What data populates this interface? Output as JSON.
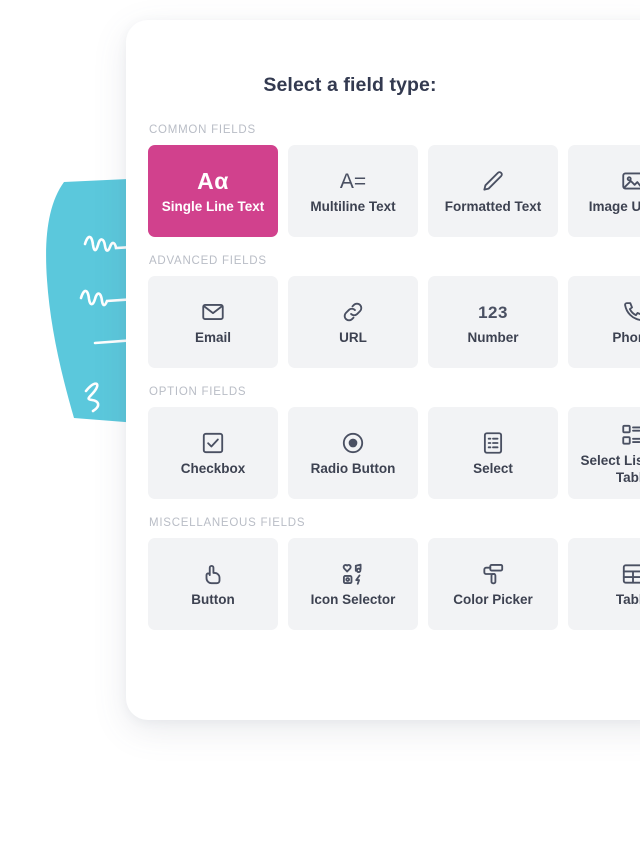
{
  "panel": {
    "title": "Select a field type:"
  },
  "colors": {
    "accent_pink": "#d1418d",
    "cyan_shape": "#5bc8dc",
    "card_background": "#f2f3f5",
    "card_text": "#3d4251",
    "section_label": "#b9bdc6",
    "panel_background": "#ffffff",
    "page_background": "#ffffff"
  },
  "sections": [
    {
      "label": "COMMON FIELDS",
      "cards": [
        {
          "label": "Single Line Text",
          "icon": "aa-text-icon",
          "selected": true
        },
        {
          "label": "Multiline Text",
          "icon": "multiline-text-icon",
          "selected": false
        },
        {
          "label": "Formatted Text",
          "icon": "pencil-icon",
          "selected": false
        },
        {
          "label": "Image Upload",
          "icon": "image-icon",
          "selected": false
        }
      ]
    },
    {
      "label": "ADVANCED FIELDS",
      "cards": [
        {
          "label": "Email",
          "icon": "envelope-icon",
          "selected": false
        },
        {
          "label": "URL",
          "icon": "link-icon",
          "selected": false
        },
        {
          "label": "Number",
          "icon": "number-123-icon",
          "selected": false
        },
        {
          "label": "Phone",
          "icon": "phone-icon",
          "selected": false
        }
      ]
    },
    {
      "label": "OPTION FIELDS",
      "cards": [
        {
          "label": "Checkbox",
          "icon": "checkbox-icon",
          "selected": false
        },
        {
          "label": "Radio Button",
          "icon": "radio-button-icon",
          "selected": false
        },
        {
          "label": "Select",
          "icon": "list-clipboard-icon",
          "selected": false
        },
        {
          "label": "Select List From Table",
          "icon": "select-list-table-icon",
          "selected": false
        }
      ]
    },
    {
      "label": "MISCELLANEOUS FIELDS",
      "cards": [
        {
          "label": "Button",
          "icon": "pointing-hand-icon",
          "selected": false
        },
        {
          "label": "Icon Selector",
          "icon": "icon-grid-icon",
          "selected": false
        },
        {
          "label": "Color Picker",
          "icon": "paint-roller-icon",
          "selected": false
        },
        {
          "label": "Table",
          "icon": "table-grid-icon",
          "selected": false
        }
      ]
    }
  ],
  "decoration": {
    "shape_name": "cyan-brush-stroke-with-scribbles"
  }
}
